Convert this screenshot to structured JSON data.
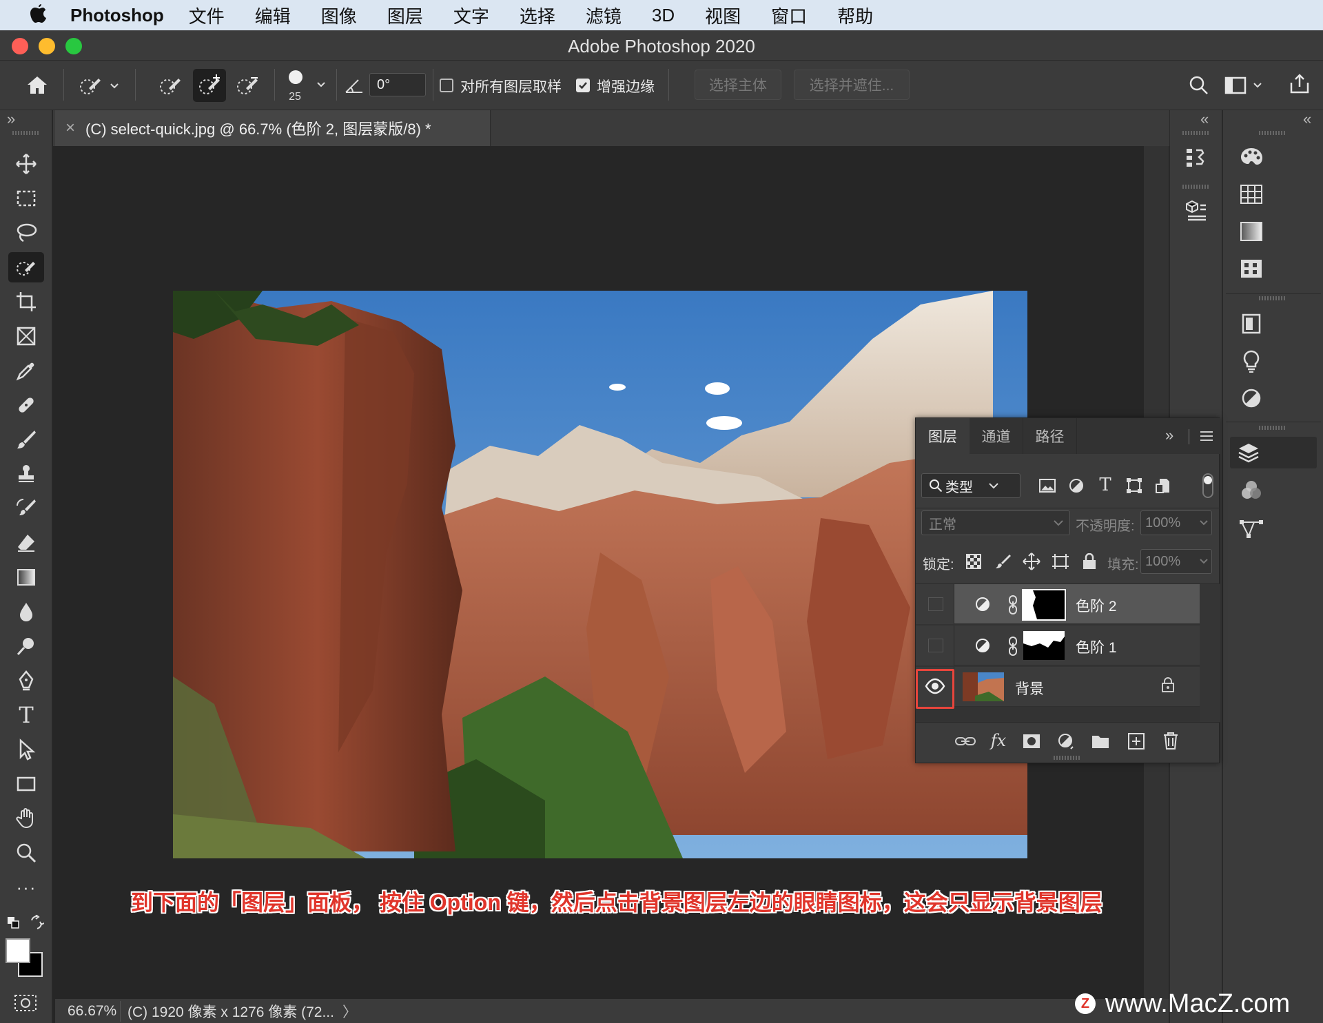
{
  "menubar": {
    "app_name": "Photoshop",
    "items": [
      "文件",
      "编辑",
      "图像",
      "图层",
      "文字",
      "选择",
      "滤镜",
      "3D",
      "视图",
      "窗口",
      "帮助"
    ]
  },
  "window": {
    "title": "Adobe Photoshop 2020",
    "traffic_lights": {
      "close": "#fe5f57",
      "minimize": "#febc2e",
      "zoom": "#28c840"
    }
  },
  "options_bar": {
    "brush_size": "25",
    "angle": "0°",
    "sample_all_layers_label": "对所有图层取样",
    "sample_all_layers_checked": false,
    "enhance_edge_label": "增强边缘",
    "enhance_edge_checked": true,
    "select_subject_label": "选择主体",
    "select_and_mask_label": "选择并遮住..."
  },
  "document": {
    "tab_title": "(C) select-quick.jpg @ 66.7% (色阶 2, 图层蒙版/8) *",
    "close_glyph": "×",
    "zoom": "66.67%",
    "status_info": "(C) 1920 像素 x 1276 像素 (72...",
    "status_arrow": "〉"
  },
  "toolbar": {
    "collapse_glyph": "»",
    "tools": [
      "move-tool",
      "marquee-tool",
      "lasso-tool",
      "quick-selection-tool",
      "crop-tool",
      "frame-tool",
      "eyedropper-tool",
      "healing-brush-tool",
      "brush-tool",
      "clone-stamp-tool",
      "history-brush-tool",
      "eraser-tool",
      "gradient-tool",
      "blur-tool",
      "dodge-tool",
      "pen-tool",
      "type-tool",
      "path-selection-tool",
      "rectangle-tool",
      "hand-tool",
      "zoom-tool",
      "more-tools"
    ],
    "selected_tool": "quick-selection-tool",
    "type_glyph": "T",
    "more_glyph": "···"
  },
  "docks": {
    "collapse_glyph": "«"
  },
  "layers_panel": {
    "tabs": [
      "图层",
      "通道",
      "路径"
    ],
    "active_tab": "图层",
    "menu_glyph": "»",
    "filter_label": "类型",
    "blend_mode": "正常",
    "opacity_label": "不透明度:",
    "opacity_value": "100%",
    "lock_label": "锁定:",
    "fill_label": "填充:",
    "fill_value": "100%",
    "type_filter_glyph": "T",
    "fx_label": "fx",
    "layers": [
      {
        "name": "色阶 2",
        "visible": false,
        "selected": true,
        "kind": "adjustment"
      },
      {
        "name": "色阶 1",
        "visible": false,
        "selected": false,
        "kind": "adjustment"
      },
      {
        "name": "背景",
        "visible": true,
        "selected": false,
        "kind": "background",
        "locked": true
      }
    ]
  },
  "caption": "到下面的「图层」面板， 按住 Option 键，然后点击背景图层左边的眼睛图标，这会只显示背景图层",
  "watermark": "www.MacZ.com",
  "watermark_logo": "Z",
  "colors": {
    "highlight_box": "#e8453c",
    "caption_text": "#e0352b"
  }
}
